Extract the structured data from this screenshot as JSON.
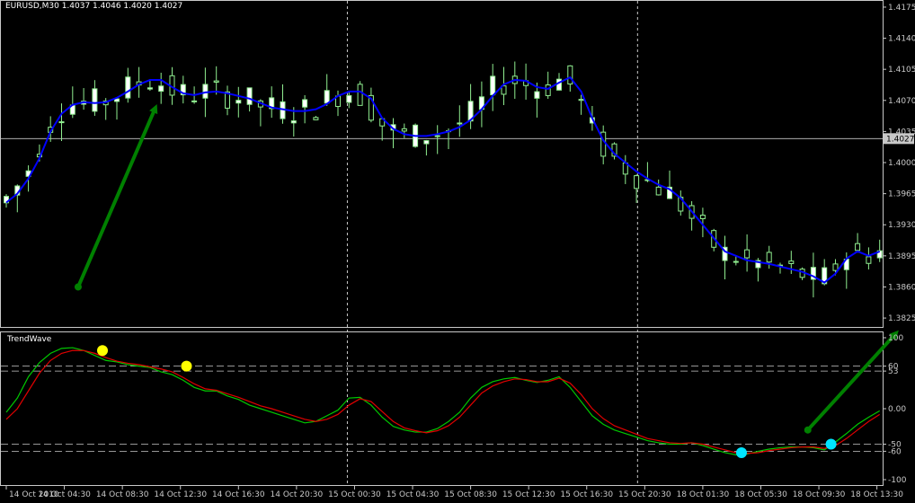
{
  "chart_data": [
    {
      "type": "candlestick",
      "symbol_info": "EURUSD,M30  1.4037 1.4046 1.4020 1.4027",
      "current_price": "1.4027",
      "current_price_value": 1.4027,
      "y_ticks": [
        "1.4175",
        "1.4140",
        "1.4105",
        "1.4070",
        "1.4035",
        "1.4000",
        "1.3965",
        "1.3930",
        "1.3895",
        "1.3860",
        "1.3825"
      ],
      "y_tick_values": [
        1.4175,
        1.414,
        1.4105,
        1.407,
        1.4035,
        1.4,
        1.3965,
        1.393,
        1.3895,
        1.386,
        1.3825
      ],
      "ylim": [
        1.3818,
        1.418
      ],
      "x_ticks": [
        "14 Oct 2010",
        "14 Oct 04:30",
        "14 Oct 08:30",
        "14 Oct 12:30",
        "14 Oct 16:30",
        "14 Oct 20:30",
        "15 Oct 00:30",
        "15 Oct 04:30",
        "15 Oct 08:30",
        "15 Oct 12:30",
        "15 Oct 16:30",
        "15 Oct 20:30",
        "18 Oct 01:30",
        "18 Oct 05:30",
        "18 Oct 09:30",
        "18 Oct 13:30"
      ],
      "session_separators": [
        "15 Oct 00:30",
        "15 Oct 20:30"
      ],
      "colors": {
        "candle_up": "#ffffff",
        "candle_down": "#90ee90",
        "wick": "#90ee90",
        "ma": "#0000ff",
        "crosshair": "#c8c8c8",
        "arrow": "#008000"
      },
      "ma_values": [
        1.3955,
        1.3965,
        1.3982,
        1.4005,
        1.4035,
        1.4055,
        1.4065,
        1.4068,
        1.4067,
        1.4068,
        1.4073,
        1.408,
        1.4088,
        1.4093,
        1.4093,
        1.4085,
        1.4078,
        1.4076,
        1.4079,
        1.408,
        1.4078,
        1.4075,
        1.4072,
        1.4067,
        1.4062,
        1.406,
        1.4058,
        1.4058,
        1.406,
        1.4066,
        1.4075,
        1.408,
        1.408,
        1.4072,
        1.405,
        1.4038,
        1.4032,
        1.403,
        1.403,
        1.4032,
        1.4035,
        1.404,
        1.4048,
        1.406,
        1.4075,
        1.4088,
        1.4093,
        1.4092,
        1.4085,
        1.4083,
        1.409,
        1.4096,
        1.408,
        1.405,
        1.4025,
        1.401,
        1.4,
        1.399,
        1.3982,
        1.3975,
        1.397,
        1.396,
        1.3945,
        1.393,
        1.3915,
        1.39,
        1.3895,
        1.389,
        1.3888,
        1.3886,
        1.3883,
        1.388,
        1.3877,
        1.3872,
        1.3865,
        1.3875,
        1.3892,
        1.39,
        1.3895,
        1.39
      ],
      "arrows": [
        {
          "from_x_index": 6.5,
          "from_price": 1.386,
          "to_x_index": 13.5,
          "to_price": 1.4062
        },
        {
          "from_x_index": 72.5,
          "from_oscillator": -30,
          "to_x_index": 80.5,
          "to_oscillator": 75
        }
      ]
    },
    {
      "type": "line",
      "title": "TrendWave",
      "y_ticks": [
        "100",
        "60",
        "53",
        "0.00",
        "-50",
        "-60",
        "-100"
      ],
      "y_tick_values": [
        100,
        60,
        53,
        0,
        -50,
        -60,
        -100
      ],
      "ylim": [
        -100,
        100
      ],
      "levels": [
        60,
        53,
        -50,
        -60
      ],
      "series": [
        {
          "color": "#00c800",
          "values": [
            -5,
            15,
            45,
            65,
            78,
            85,
            86,
            82,
            75,
            68,
            66,
            62,
            60,
            58,
            52,
            48,
            40,
            30,
            25,
            25,
            18,
            13,
            5,
            0,
            -5,
            -10,
            -15,
            -20,
            -18,
            -10,
            -2,
            15,
            16,
            5,
            -12,
            -25,
            -30,
            -33,
            -33,
            -28,
            -18,
            -5,
            15,
            30,
            38,
            42,
            44,
            40,
            37,
            40,
            45,
            30,
            10,
            -10,
            -22,
            -30,
            -35,
            -40,
            -45,
            -48,
            -50,
            -50,
            -48,
            -52,
            -57,
            -62,
            -65,
            -64,
            -60,
            -57,
            -55,
            -54,
            -54,
            -55,
            -58,
            -47,
            -35,
            -22,
            -12,
            -3
          ]
        },
        {
          "color": "#e00000",
          "values": [
            -15,
            0,
            25,
            50,
            68,
            78,
            82,
            82,
            78,
            72,
            67,
            64,
            62,
            59,
            56,
            52,
            44,
            35,
            28,
            26,
            21,
            16,
            10,
            4,
            0,
            -5,
            -10,
            -15,
            -18,
            -15,
            -8,
            5,
            14,
            10,
            -4,
            -18,
            -27,
            -31,
            -34,
            -31,
            -24,
            -12,
            5,
            22,
            32,
            38,
            42,
            41,
            38,
            38,
            43,
            36,
            20,
            0,
            -14,
            -24,
            -30,
            -36,
            -42,
            -45,
            -48,
            -49,
            -48,
            -50,
            -54,
            -58,
            -62,
            -63,
            -62,
            -59,
            -57,
            -55,
            -54,
            -54,
            -56,
            -52,
            -42,
            -30,
            -18,
            -8
          ]
        }
      ],
      "signal_markers": [
        {
          "x_index": 8.7,
          "value": 82,
          "color": "#ffff00"
        },
        {
          "x_index": 16.3,
          "value": 60,
          "color": "#ffff00"
        },
        {
          "x_index": 66.5,
          "value": -62,
          "color": "#00e5ff"
        },
        {
          "x_index": 74.6,
          "value": -50,
          "color": "#00e5ff"
        }
      ]
    }
  ]
}
